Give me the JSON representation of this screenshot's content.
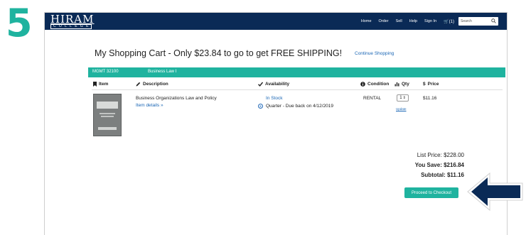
{
  "step": {
    "number": "5"
  },
  "navbar": {
    "logo_main": "HIRAM",
    "logo_sub": "COLLEGE",
    "links": [
      "Home",
      "Order",
      "Sell",
      "Help",
      "Sign In"
    ],
    "cart_label": "(1)",
    "search_placeholder": "Search"
  },
  "cart": {
    "title": "My Shopping Cart - Only $23.84 to go to get FREE SHIPPING!",
    "continue_label": "Continue Shopping"
  },
  "course": {
    "code": "MGMT  32100",
    "name": "Business Law I"
  },
  "columns": {
    "item": "Item",
    "description": "Description",
    "availability": "Availability",
    "condition": "Condition",
    "qty": "Qty",
    "price": "Price"
  },
  "row": {
    "title": "Business Organizations Law and Policy",
    "details_link": "Item details »",
    "availability": "In Stock",
    "rental_option": "Quarter - Due back on 4/12/2019",
    "condition": "RENTAL",
    "qty": "1",
    "update_label": "Update",
    "price": "$11.16"
  },
  "summary": {
    "list_price": "List Price: $228.00",
    "you_save": "You Save: $216.84",
    "subtotal": "Subtotal: $11.16"
  },
  "checkout_label": "Proceed to Checkout",
  "colors": {
    "accent": "#1fb39f",
    "navbar": "#0a2a56",
    "arrow": "#0a2a56",
    "link": "#1a66b5"
  }
}
